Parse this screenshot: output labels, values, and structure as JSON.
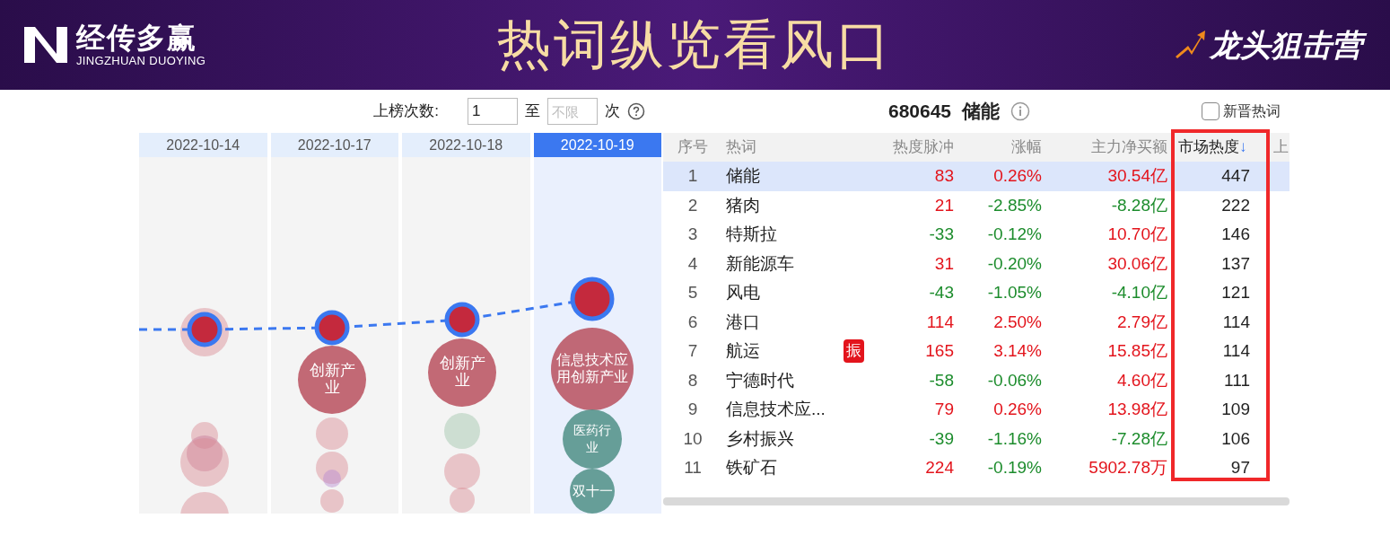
{
  "banner": {
    "brand": "经传多赢",
    "brand_latin": "JINGZHUAN DUOYING",
    "title": "热词纵览看风口",
    "camp": "龙头狙击营"
  },
  "filter": {
    "label": "上榜次数:",
    "from": "1",
    "to_label": "至",
    "to_placeholder": "不限",
    "unit": "次"
  },
  "dates": [
    {
      "label": "2022-10-14",
      "selected": false
    },
    {
      "label": "2022-10-17",
      "selected": false,
      "bubble_labels": [
        "创新产业"
      ]
    },
    {
      "label": "2022-10-18",
      "selected": false,
      "bubble_labels": [
        "创新产业"
      ]
    },
    {
      "label": "2022-10-19",
      "selected": true,
      "bubble_labels": [
        "信息技术应用创新产业",
        "医药行业",
        "双十一"
      ]
    }
  ],
  "detail": {
    "code": "680645",
    "name": "储能",
    "new_words_label": "新晋热词",
    "new_words_checked": false
  },
  "table": {
    "columns": [
      {
        "label": "序号",
        "sorted": false
      },
      {
        "label": "热词",
        "sorted": false
      },
      {
        "label": "热度脉冲",
        "sorted": false
      },
      {
        "label": "涨幅",
        "sorted": false
      },
      {
        "label": "主力净买额",
        "sorted": false
      },
      {
        "label": "市场热度",
        "sorted": true,
        "sort_mark": "↓"
      },
      {
        "label": "上",
        "sorted": false
      }
    ],
    "rows": [
      {
        "rank": "1",
        "word": "储能",
        "pulse": "83",
        "pulse_rise": true,
        "change": "0.26%",
        "change_rise": true,
        "net": "30.54亿",
        "net_rise": true,
        "heat": "447",
        "selected": true
      },
      {
        "rank": "2",
        "word": "猪肉",
        "pulse": "21",
        "pulse_rise": true,
        "change": "-2.85%",
        "change_rise": false,
        "net": "-8.28亿",
        "net_rise": false,
        "heat": "222",
        "selected": false
      },
      {
        "rank": "3",
        "word": "特斯拉",
        "pulse": "-33",
        "pulse_rise": false,
        "change": "-0.12%",
        "change_rise": false,
        "net": "10.70亿",
        "net_rise": true,
        "heat": "146",
        "selected": false
      },
      {
        "rank": "4",
        "word": "新能源车",
        "pulse": "31",
        "pulse_rise": true,
        "change": "-0.20%",
        "change_rise": false,
        "net": "30.06亿",
        "net_rise": true,
        "heat": "137",
        "selected": false
      },
      {
        "rank": "5",
        "word": "风电",
        "pulse": "-43",
        "pulse_rise": false,
        "change": "-1.05%",
        "change_rise": false,
        "net": "-4.10亿",
        "net_rise": false,
        "heat": "121",
        "selected": false
      },
      {
        "rank": "6",
        "word": "港口",
        "pulse": "114",
        "pulse_rise": true,
        "change": "2.50%",
        "change_rise": true,
        "net": "2.79亿",
        "net_rise": true,
        "heat": "114",
        "selected": false
      },
      {
        "rank": "7",
        "word": "航运",
        "badge": "振",
        "pulse": "165",
        "pulse_rise": true,
        "change": "3.14%",
        "change_rise": true,
        "net": "15.85亿",
        "net_rise": true,
        "heat": "114",
        "selected": false
      },
      {
        "rank": "8",
        "word": "宁德时代",
        "pulse": "-58",
        "pulse_rise": false,
        "change": "-0.06%",
        "change_rise": false,
        "net": "4.60亿",
        "net_rise": true,
        "heat": "111",
        "selected": false
      },
      {
        "rank": "9",
        "word": "信息技术应...",
        "pulse": "79",
        "pulse_rise": true,
        "change": "0.26%",
        "change_rise": true,
        "net": "13.98亿",
        "net_rise": true,
        "heat": "109",
        "selected": false
      },
      {
        "rank": "10",
        "word": "乡村振兴",
        "pulse": "-39",
        "pulse_rise": false,
        "change": "-1.16%",
        "change_rise": false,
        "net": "-7.28亿",
        "net_rise": false,
        "heat": "106",
        "selected": false
      },
      {
        "rank": "11",
        "word": "铁矿石",
        "pulse": "224",
        "pulse_rise": true,
        "change": "-0.19%",
        "change_rise": false,
        "net": "5902.78万",
        "net_rise": true,
        "heat": "97",
        "selected": false
      }
    ]
  }
}
